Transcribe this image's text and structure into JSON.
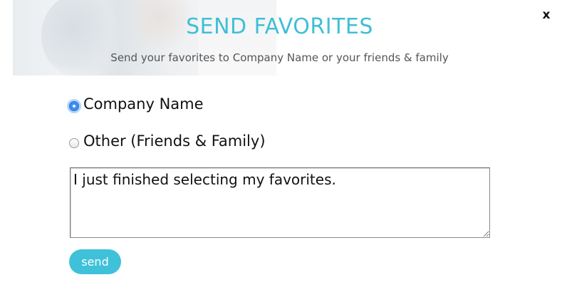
{
  "dialog": {
    "title": "SEND FAVORITES",
    "subtitle": "Send your favorites to Company Name or your friends & family",
    "close_label": "x",
    "accent_color": "#3fbfd6"
  },
  "recipients": {
    "options": [
      {
        "label": "Company Name",
        "selected": true
      },
      {
        "label": "Other (Friends & Family)",
        "selected": false
      }
    ]
  },
  "message": {
    "value": "I just finished selecting my favorites."
  },
  "actions": {
    "send_label": "send",
    "send_color": "#3fc1d9"
  },
  "icons": {
    "close": "close-icon",
    "radio_selected": "radio-checked-icon",
    "radio_unselected": "radio-unchecked-icon"
  }
}
